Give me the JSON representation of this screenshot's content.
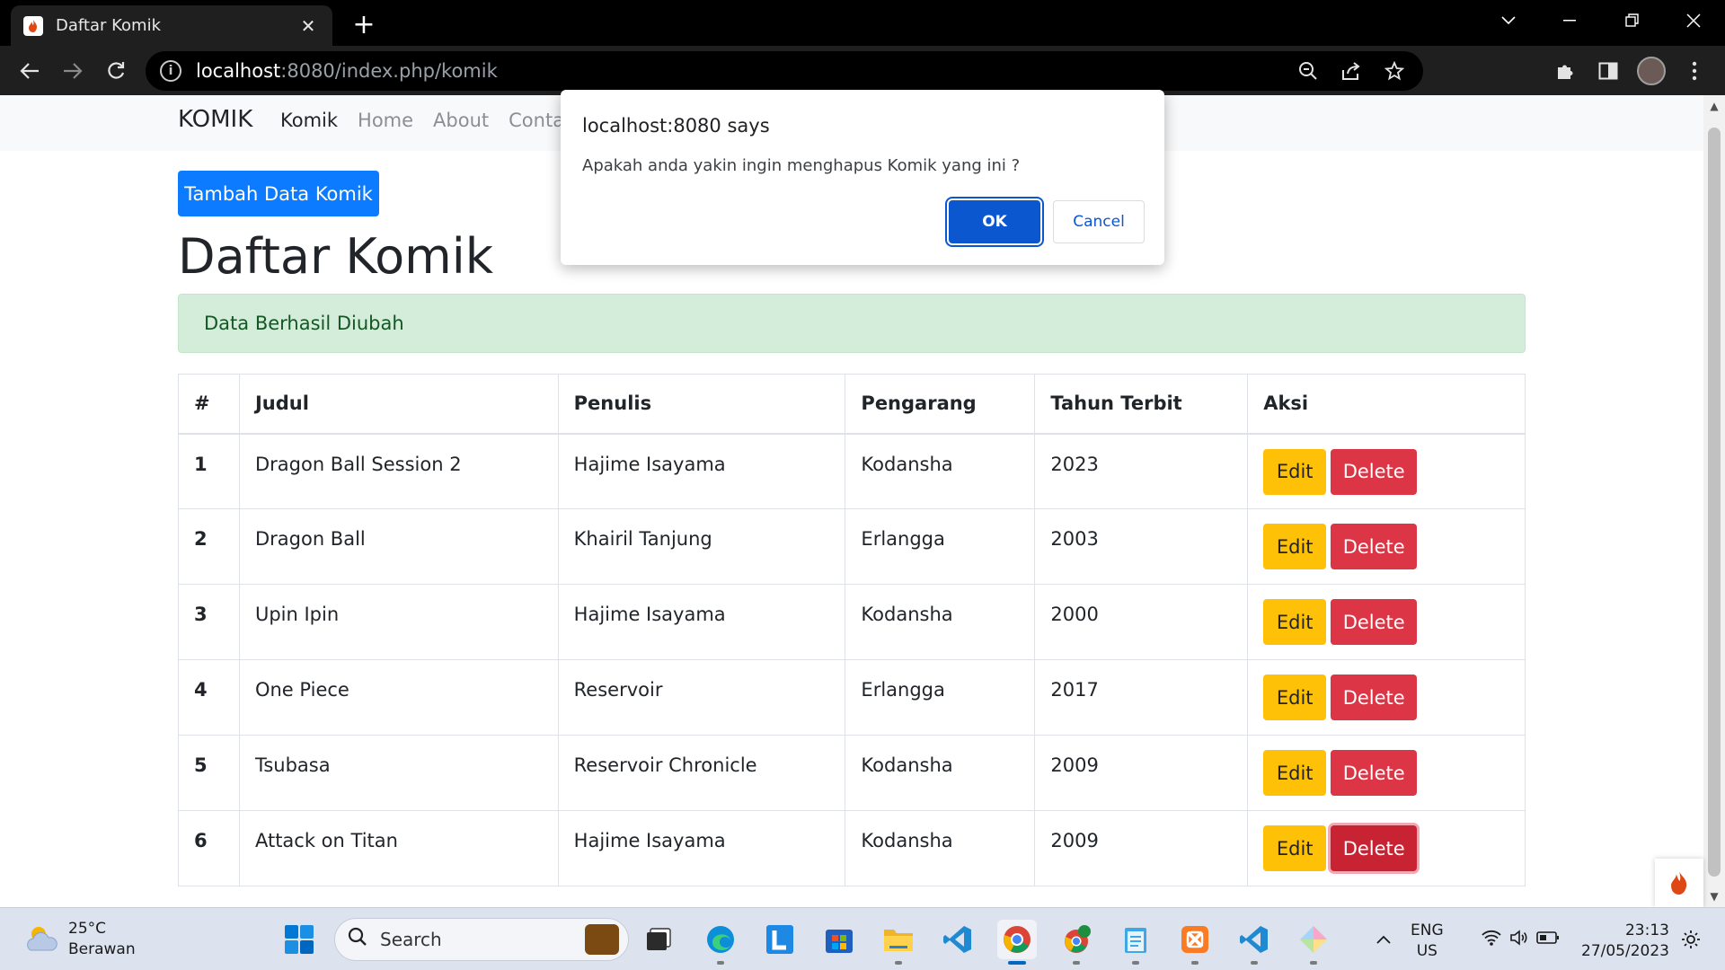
{
  "browser": {
    "tab_title": "Daftar Komik",
    "url_host": "localhost",
    "url_rest": ":8080/index.php/komik"
  },
  "navbar": {
    "brand": "KOMIK",
    "links": [
      "Komik",
      "Home",
      "About",
      "Contact"
    ]
  },
  "page": {
    "add_button": "Tambah Data Komik",
    "title": "Daftar Komik",
    "alert": "Data Berhasil Diubah"
  },
  "table": {
    "headers": [
      "#",
      "Judul",
      "Penulis",
      "Pengarang",
      "Tahun Terbit",
      "Aksi"
    ],
    "rows": [
      {
        "no": "1",
        "judul": "Dragon Ball Session 2",
        "penulis": "Hajime Isayama",
        "pengarang": "Kodansha",
        "tahun": "2023"
      },
      {
        "no": "2",
        "judul": "Dragon Ball",
        "penulis": "Khairil Tanjung",
        "pengarang": "Erlangga",
        "tahun": "2003"
      },
      {
        "no": "3",
        "judul": "Upin Ipin",
        "penulis": "Hajime Isayama",
        "pengarang": "Kodansha",
        "tahun": "2000"
      },
      {
        "no": "4",
        "judul": "One Piece",
        "penulis": "Reservoir",
        "pengarang": "Erlangga",
        "tahun": "2017"
      },
      {
        "no": "5",
        "judul": "Tsubasa",
        "penulis": "Reservoir Chronicle",
        "pengarang": "Kodansha",
        "tahun": "2009"
      },
      {
        "no": "6",
        "judul": "Attack on Titan",
        "penulis": "Hajime Isayama",
        "pengarang": "Kodansha",
        "tahun": "2009"
      }
    ],
    "edit_label": "Edit",
    "delete_label": "Delete"
  },
  "dialog": {
    "title": "localhost:8080 says",
    "message": "Apakah anda yakin ingin menghapus Komik yang ini ?",
    "ok_label": "OK",
    "cancel_label": "Cancel"
  },
  "taskbar": {
    "temperature": "25°C",
    "weather": "Berawan",
    "search_placeholder": "Search",
    "language": "ENG",
    "region": "US",
    "time": "23:13",
    "date": "27/05/2023"
  },
  "colors": {
    "primary": "#0d7bff",
    "warning": "#ffc107",
    "danger": "#dc3545",
    "success_bg": "#d4edda",
    "dialog_button": "#0b57d0"
  }
}
